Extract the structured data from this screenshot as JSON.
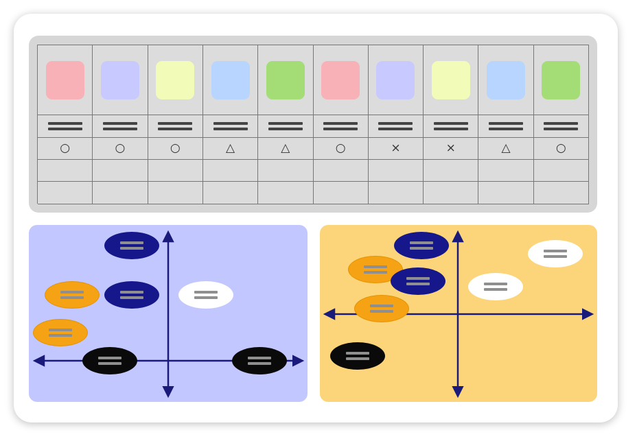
{
  "table": {
    "swatch_colors": [
      "#f8b1b7",
      "#c8caff",
      "#f2fbb8",
      "#b7d5ff",
      "#a4dc76",
      "#f8b1b7",
      "#c8caff",
      "#f2fbb8",
      "#b7d5ff",
      "#a4dc76"
    ],
    "marks": [
      "○",
      "○",
      "○",
      "△",
      "△",
      "○",
      "×",
      "×",
      "△",
      "○"
    ]
  },
  "colors": {
    "navy": "#15178a",
    "orange": "#f5a214",
    "white": "#ffffff",
    "black": "#0a0a0a",
    "axis": "#1a1a7a",
    "left_panel_bg": "#c3c7ff",
    "right_panel_bg": "#fcd57a"
  }
}
